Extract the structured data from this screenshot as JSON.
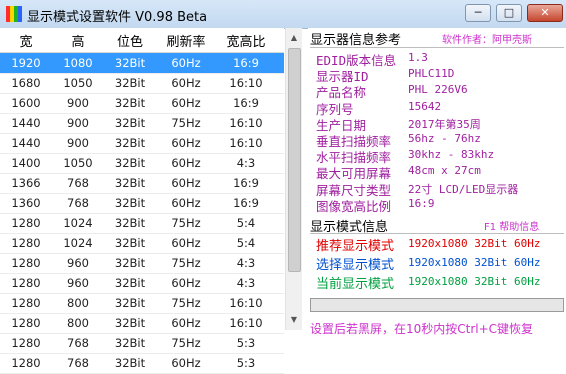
{
  "window": {
    "title": "显示模式设置软件 V0.98 Beta",
    "controls": {
      "minimize": "─",
      "maximize": "□",
      "close": "✕"
    }
  },
  "table": {
    "headers": [
      "宽",
      "高",
      "位色",
      "刷新率",
      "宽高比"
    ],
    "selected_index": 0,
    "rows": [
      [
        "1920",
        "1080",
        "32Bit",
        "60Hz",
        "16:9"
      ],
      [
        "1680",
        "1050",
        "32Bit",
        "60Hz",
        "16:10"
      ],
      [
        "1600",
        "900",
        "32Bit",
        "60Hz",
        "16:9"
      ],
      [
        "1440",
        "900",
        "32Bit",
        "75Hz",
        "16:10"
      ],
      [
        "1440",
        "900",
        "32Bit",
        "60Hz",
        "16:10"
      ],
      [
        "1400",
        "1050",
        "32Bit",
        "60Hz",
        "4:3"
      ],
      [
        "1366",
        "768",
        "32Bit",
        "60Hz",
        "16:9"
      ],
      [
        "1360",
        "768",
        "32Bit",
        "60Hz",
        "16:9"
      ],
      [
        "1280",
        "1024",
        "32Bit",
        "75Hz",
        "5:4"
      ],
      [
        "1280",
        "1024",
        "32Bit",
        "60Hz",
        "5:4"
      ],
      [
        "1280",
        "960",
        "32Bit",
        "75Hz",
        "4:3"
      ],
      [
        "1280",
        "960",
        "32Bit",
        "60Hz",
        "4:3"
      ],
      [
        "1280",
        "800",
        "32Bit",
        "75Hz",
        "16:10"
      ],
      [
        "1280",
        "800",
        "32Bit",
        "60Hz",
        "16:10"
      ],
      [
        "1280",
        "768",
        "32Bit",
        "75Hz",
        "5:3"
      ],
      [
        "1280",
        "768",
        "32Bit",
        "60Hz",
        "5:3"
      ]
    ]
  },
  "monitor_info": {
    "title": "显示器信息参考",
    "author": "软件作者：阿甲壳斯",
    "fields": [
      {
        "label": "EDID版本信息",
        "value": "1.3"
      },
      {
        "label": "显示器ID",
        "value": "PHLC11D"
      },
      {
        "label": "产品名称",
        "value": "PHL 226V6"
      },
      {
        "label": "序列号",
        "value": "15642"
      },
      {
        "label": "生产日期",
        "value": "2017年第35周"
      },
      {
        "label": "垂直扫描频率",
        "value": "56hz  -  76hz"
      },
      {
        "label": "水平扫描频率",
        "value": "30khz  -  83khz"
      },
      {
        "label": "最大可用屏幕",
        "value": "48cm x 27cm"
      },
      {
        "label": "屏幕尺寸类型",
        "value": "22寸 LCD/LED显示器"
      },
      {
        "label": "图像宽高比例",
        "value": "16:9"
      }
    ]
  },
  "display_modes": {
    "title": "显示模式信息",
    "help": "F1 帮助信息",
    "modes": [
      {
        "label": "推荐显示模式",
        "value": "1920x1080  32Bit  60Hz",
        "color": "#e00000"
      },
      {
        "label": "选择显示模式",
        "value": "1920x1080  32Bit  60Hz",
        "color": "#0050d0"
      },
      {
        "label": "当前显示模式",
        "value": "1920x1080  32Bit  60Hz",
        "color": "#00a040"
      }
    ]
  },
  "progress": {
    "value_percent": 0
  },
  "footer": {
    "text": "设置后若黑屏，在10秒内按Ctrl+C键恢复"
  },
  "colors": {
    "selection": "#3399ff",
    "info_text": "#a020a0",
    "accent": "#cc33cc"
  }
}
